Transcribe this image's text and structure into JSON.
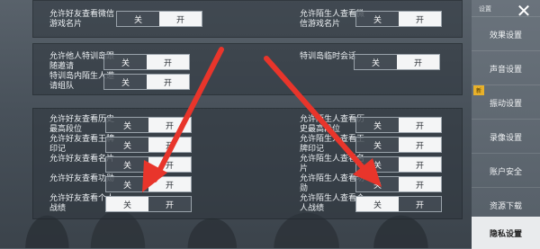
{
  "toggle_labels": {
    "off": "关",
    "on": "开"
  },
  "panel1": {
    "left_label": "允许好友查看微信游戏名片",
    "right_label": "允许陌生人查看微信游戏名片"
  },
  "panel2": {
    "left_label_1": "允许他人特训岛跟随邀请",
    "left_label_2": "特训岛内陌生人邀请组队",
    "right_label": "特训岛临时会话"
  },
  "panel3": {
    "left": [
      "允许好友查看历史最高段位",
      "允许好友查看王牌印记",
      "允许好友查看名片",
      "允许好友查看功勋",
      "允许好友查看个人战绩"
    ],
    "right": [
      "允许陌生人查看历史最高段位",
      "允许陌生人查看王牌印记",
      "允许陌生人查看名片",
      "允许陌生人查看功勋",
      "允许陌生人查看个人战绩"
    ]
  },
  "sidebar": {
    "back_label": "设置",
    "new_badge": "新",
    "items": [
      "效果设置",
      "声音设置",
      "振动设置",
      "录像设置",
      "账户安全",
      "资源下载",
      "隐私设置"
    ]
  },
  "colors": {
    "annotation_arrow": "#e8352b"
  },
  "icons": [
    "close-icon"
  ]
}
